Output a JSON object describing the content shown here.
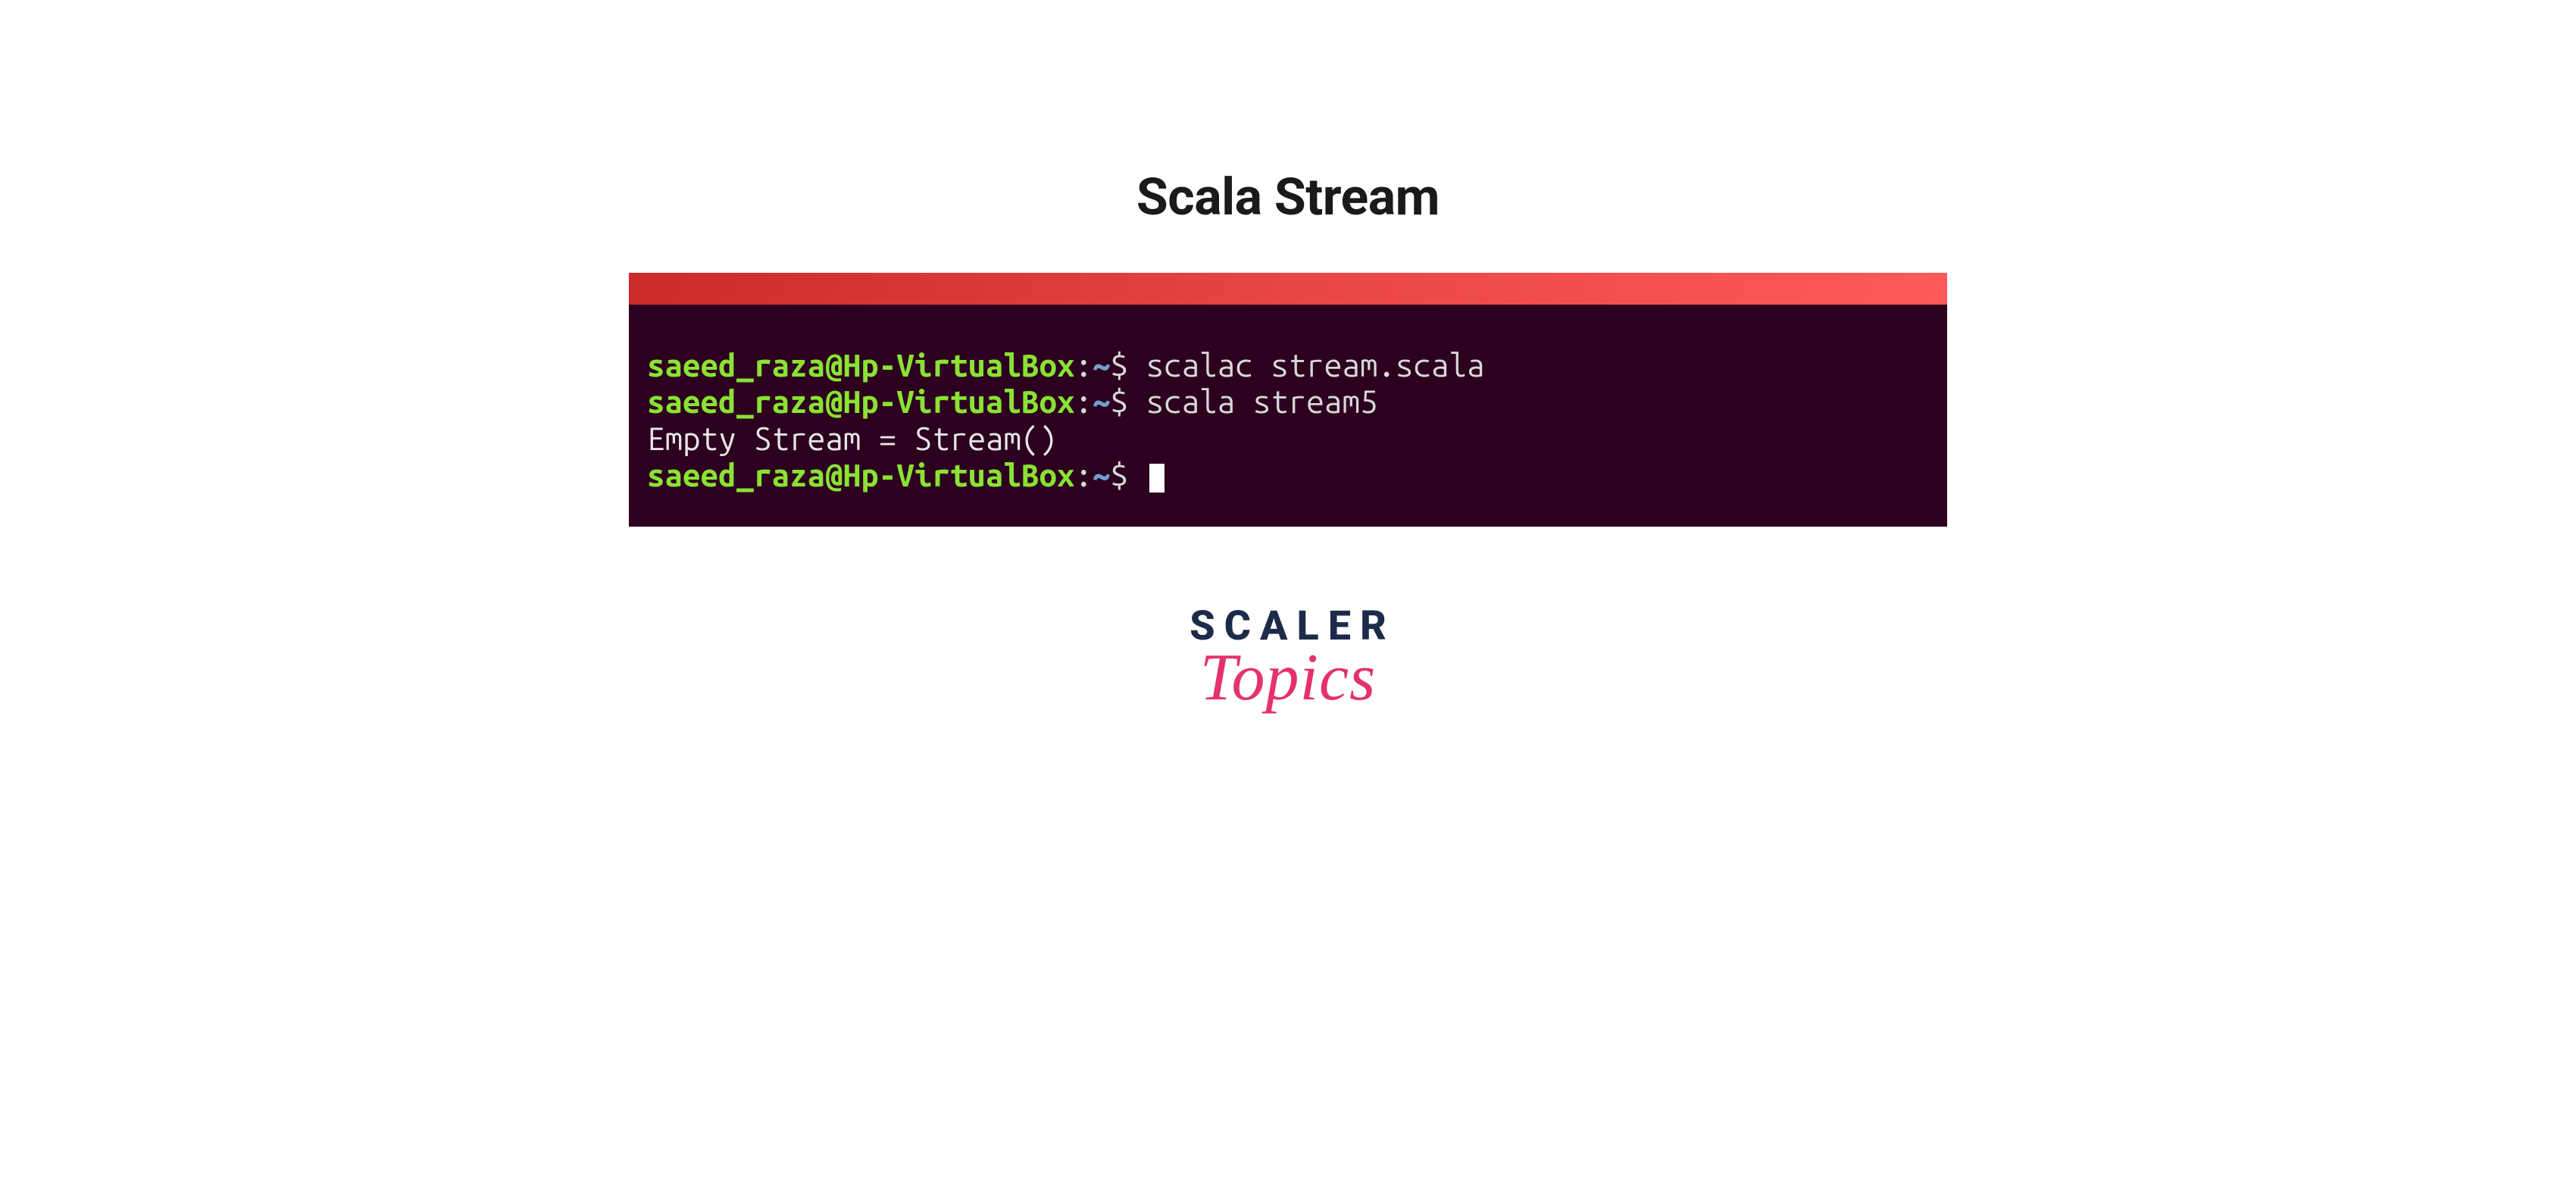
{
  "title": "Scala Stream",
  "terminal": {
    "lines": [
      {
        "user_host": "saeed_raza@Hp-VirtualBox",
        "tilde": "~",
        "dollar": "$",
        "command": " scalac stream.scala"
      },
      {
        "user_host": "saeed_raza@Hp-VirtualBox",
        "tilde": "~",
        "dollar": "$",
        "command": " scala stream5"
      }
    ],
    "output": "Empty Stream = Stream()",
    "last_prompt": {
      "user_host": "saeed_raza@Hp-VirtualBox",
      "tilde": "~",
      "dollar": "$"
    }
  },
  "brand": {
    "line1": "SCALER",
    "line2": "Topics"
  }
}
